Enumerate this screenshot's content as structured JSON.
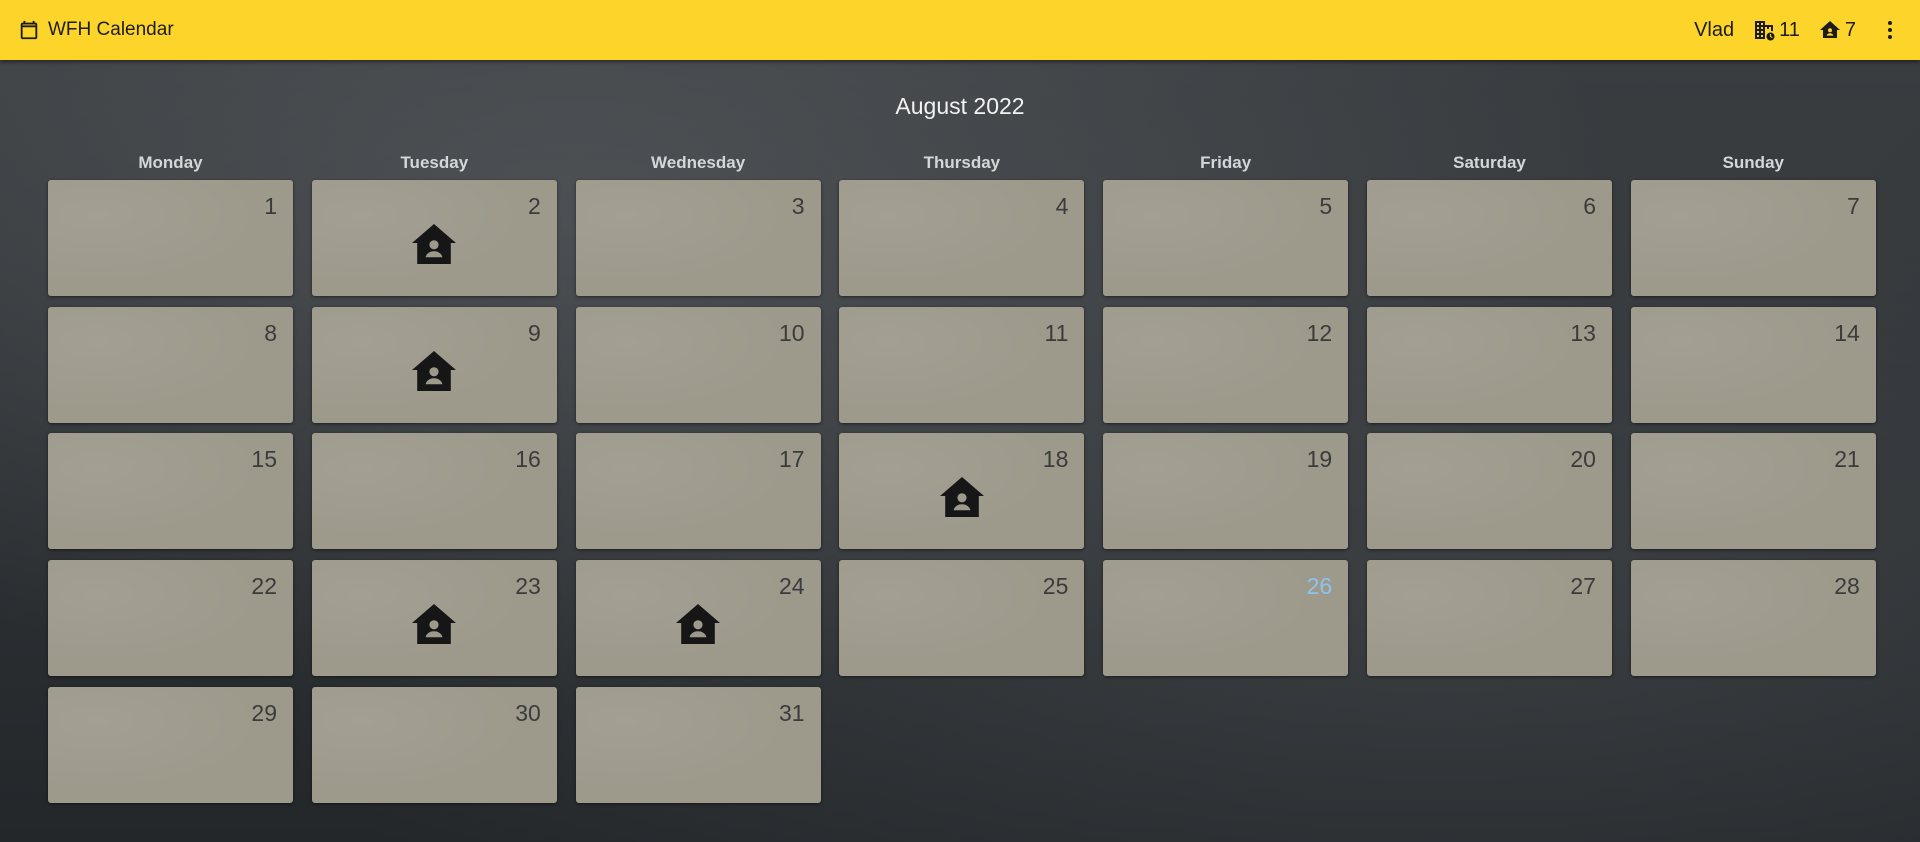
{
  "app": {
    "title": "WFH Calendar",
    "user": "Vlad"
  },
  "stats": {
    "office_days": "11",
    "home_days": "7"
  },
  "calendar": {
    "month_label": "August 2022",
    "weekdays": [
      "Monday",
      "Tuesday",
      "Wednesday",
      "Thursday",
      "Friday",
      "Saturday",
      "Sunday"
    ],
    "days": [
      {
        "n": "1"
      },
      {
        "n": "2",
        "wfh": true
      },
      {
        "n": "3"
      },
      {
        "n": "4"
      },
      {
        "n": "5"
      },
      {
        "n": "6"
      },
      {
        "n": "7"
      },
      {
        "n": "8"
      },
      {
        "n": "9",
        "wfh": true
      },
      {
        "n": "10"
      },
      {
        "n": "11"
      },
      {
        "n": "12"
      },
      {
        "n": "13"
      },
      {
        "n": "14"
      },
      {
        "n": "15"
      },
      {
        "n": "16"
      },
      {
        "n": "17"
      },
      {
        "n": "18",
        "wfh": true
      },
      {
        "n": "19"
      },
      {
        "n": "20"
      },
      {
        "n": "21"
      },
      {
        "n": "22"
      },
      {
        "n": "23",
        "wfh": true
      },
      {
        "n": "24",
        "wfh": true
      },
      {
        "n": "25"
      },
      {
        "n": "26",
        "today": true
      },
      {
        "n": "27"
      },
      {
        "n": "28"
      },
      {
        "n": "29"
      },
      {
        "n": "30"
      },
      {
        "n": "31"
      }
    ]
  },
  "colors": {
    "appbar": "#fdd52a",
    "cell": "#9d9a8c",
    "today": "#8fc3ee"
  },
  "icons": {
    "brand": "calendar-icon",
    "office": "office-building-icon",
    "home": "home-person-icon",
    "menu": "more-vert-icon"
  }
}
